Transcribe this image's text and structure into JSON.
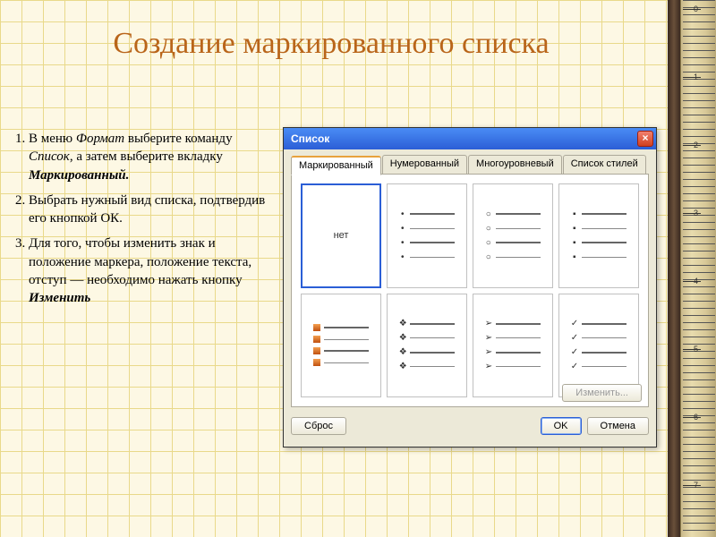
{
  "slide": {
    "title": "Создание маркированного списка"
  },
  "steps": [
    {
      "pre": "В меню ",
      "i1": "Формат",
      "mid": " выберите команду ",
      "i2": "Список",
      "mid2": ", а затем выберите вкладку ",
      "b": "Маркированный."
    },
    {
      "text": "Выбрать нужный вид списка, подтвердив его кнопкой ОК."
    },
    {
      "pre": "Для того, чтобы изменить знак и положение маркера, положение текста, отступ — необходимо нажать кнопку ",
      "b": "Изменить"
    }
  ],
  "dialog": {
    "title": "Список",
    "tabs": [
      "Маркированный",
      "Нумерованный",
      "Многоуровневый",
      "Список стилей"
    ],
    "none": "нет",
    "buttons": {
      "reset": "Сброс",
      "change": "Изменить...",
      "ok": "OK",
      "cancel": "Отмена"
    }
  },
  "ruler": {
    "marks": [
      0,
      1,
      2,
      3,
      4,
      5,
      6,
      7
    ]
  }
}
